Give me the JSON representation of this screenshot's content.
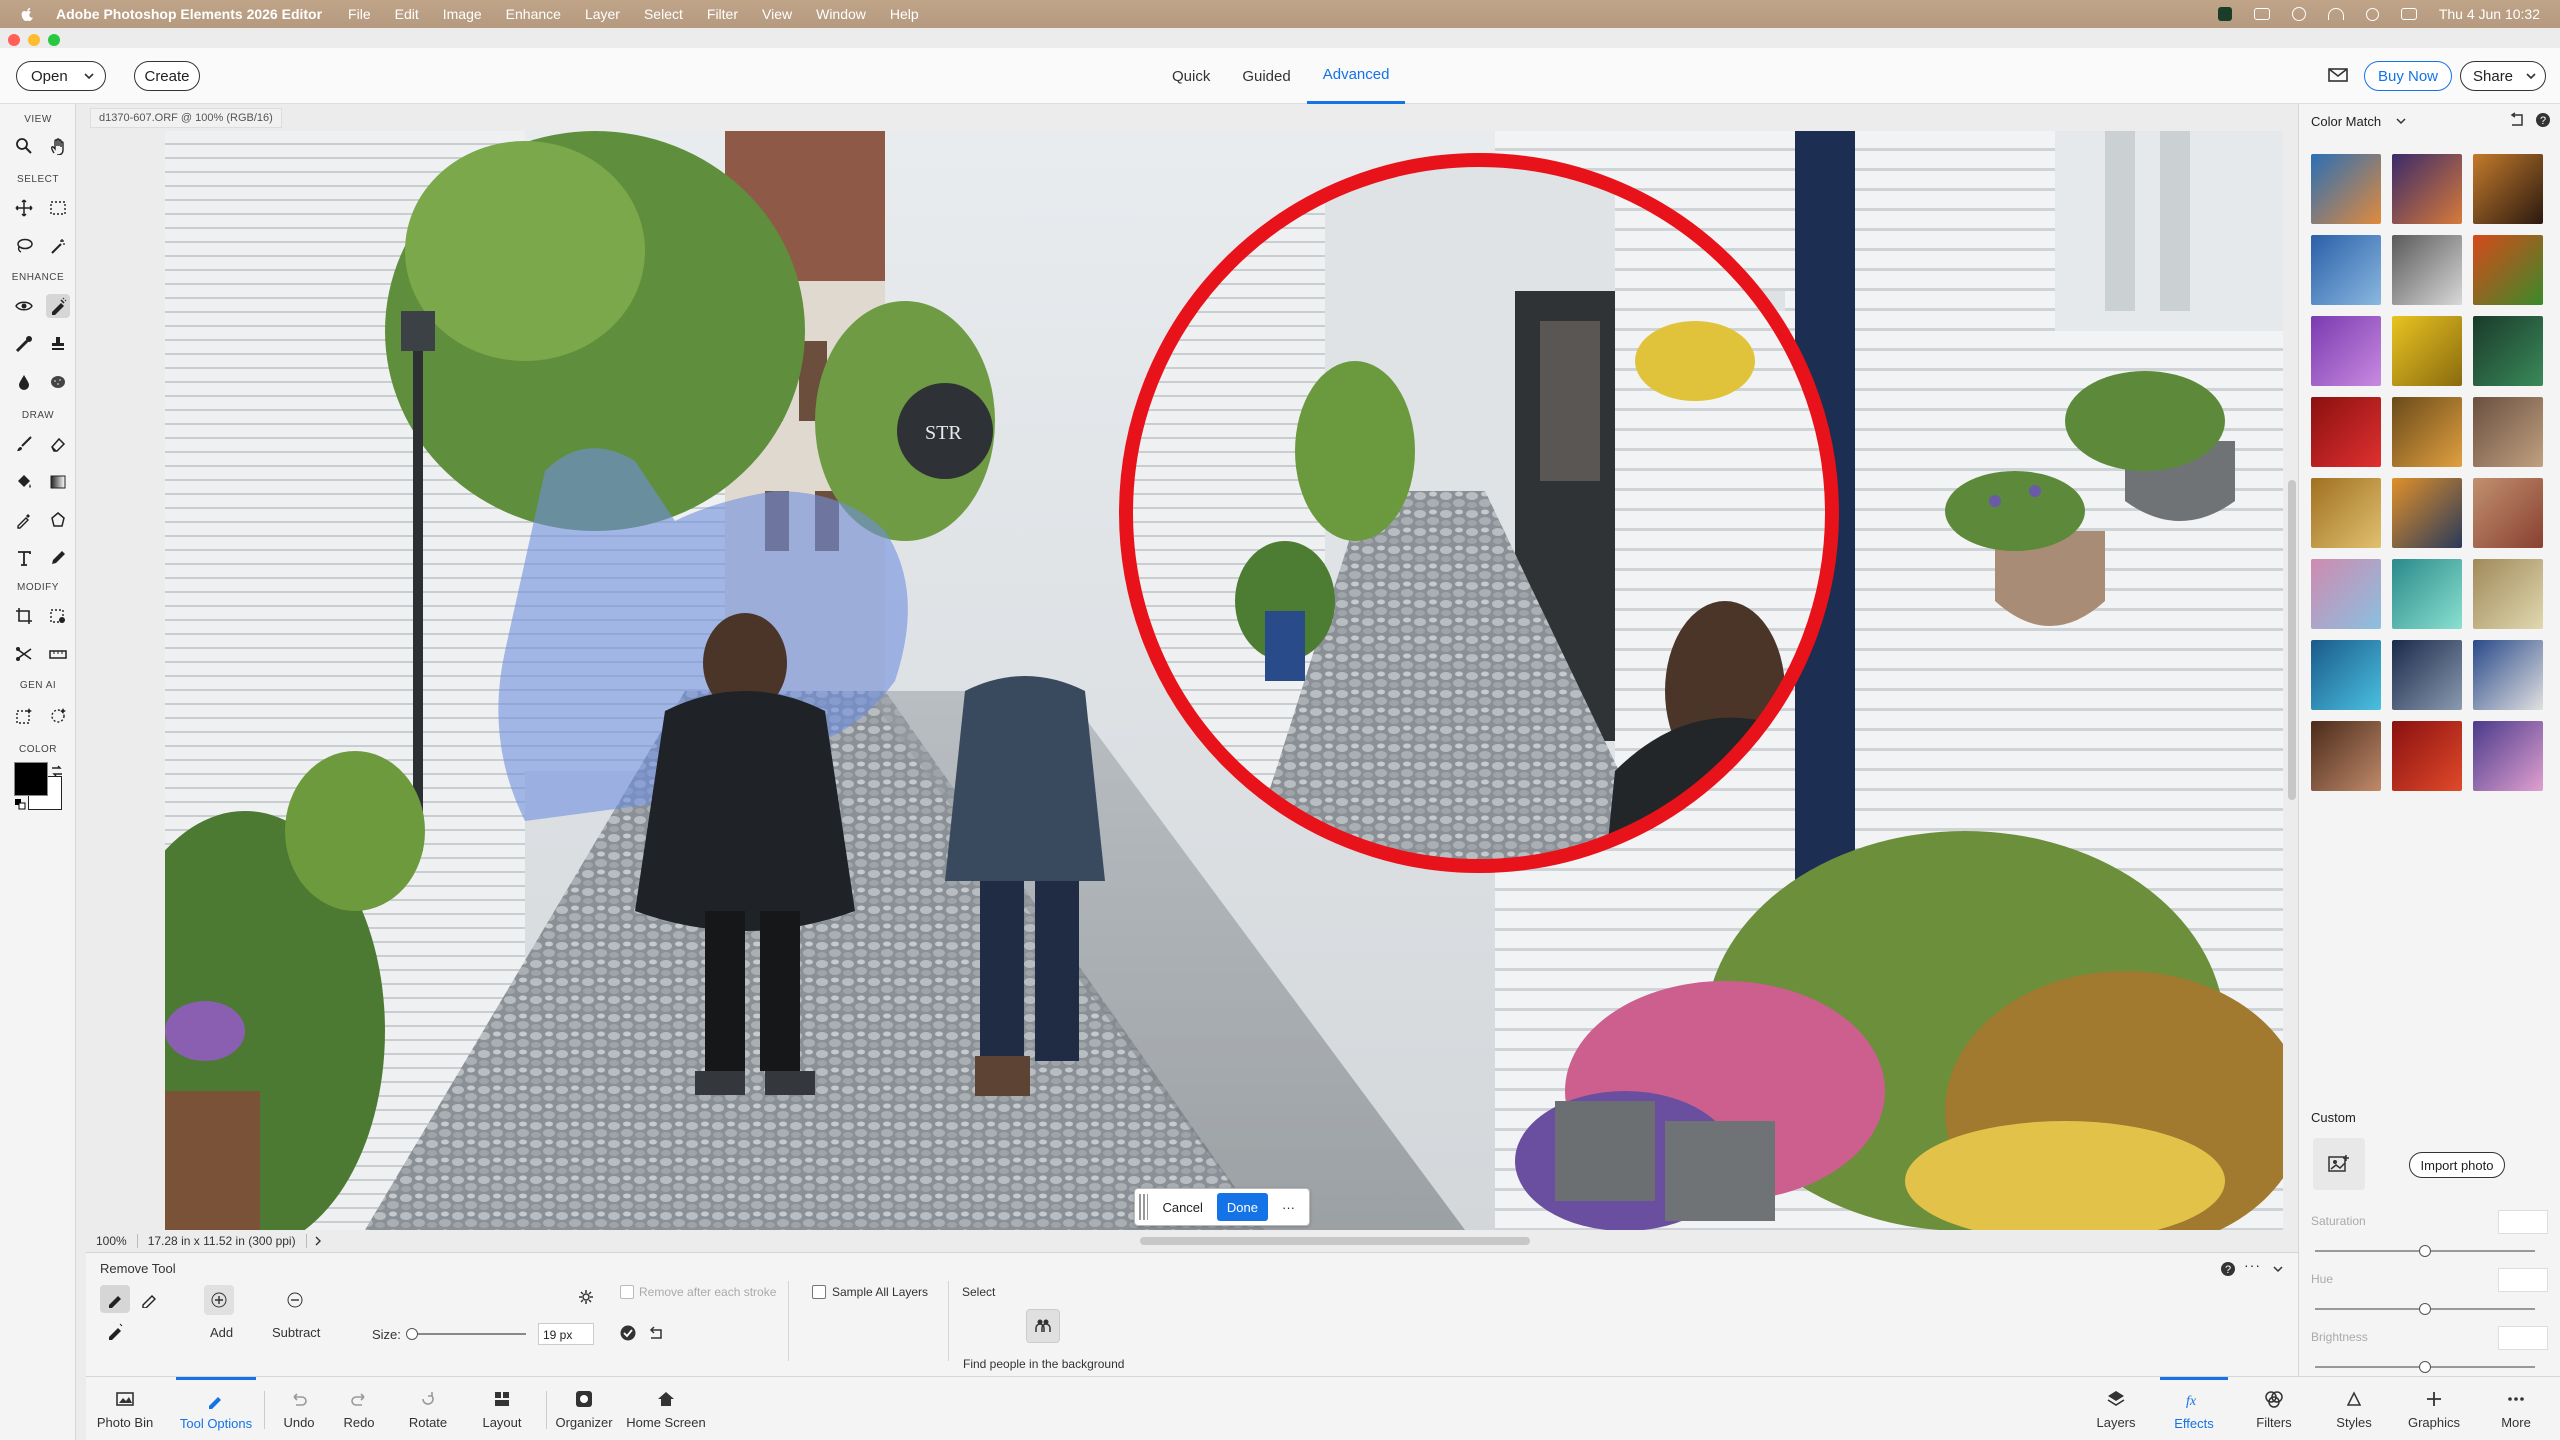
{
  "menubar": {
    "app_name": "Adobe Photoshop Elements 2026 Editor",
    "menus": [
      "File",
      "Edit",
      "Image",
      "Enhance",
      "Layer",
      "Select",
      "Filter",
      "View",
      "Window",
      "Help"
    ],
    "clock": "Thu 4 Jun  10:32"
  },
  "header": {
    "open_label": "Open",
    "create_label": "Create",
    "modes": [
      "Quick",
      "Guided",
      "Advanced"
    ],
    "active_mode": "Advanced",
    "buy_now_label": "Buy Now",
    "share_label": "Share"
  },
  "toolbox": {
    "sections": [
      "VIEW",
      "SELECT",
      "ENHANCE",
      "DRAW",
      "MODIFY",
      "GEN AI",
      "COLOR"
    ],
    "foreground_color": "#000000",
    "background_color": "#ffffff"
  },
  "document": {
    "tab_title": "d1370-607.ORF @ 100% (RGB/16)",
    "zoom": "100%",
    "dimensions": "17.28 in x 11.52 in (300 ppi)"
  },
  "donebar": {
    "cancel_label": "Cancel",
    "done_label": "Done",
    "more_label": "···"
  },
  "right_panel": {
    "title": "Color Match",
    "custom_label": "Custom",
    "import_label": "Import photo",
    "sliders": [
      "Saturation",
      "Hue",
      "Brightness"
    ]
  },
  "tool_options": {
    "tool_name": "Remove Tool",
    "add_label": "Add",
    "subtract_label": "Subtract",
    "size_label": "Size:",
    "size_value": "19 px",
    "remove_after_stroke": "Remove after each stroke",
    "sample_all_layers": "Sample All Layers",
    "select_label": "Select",
    "find_people": "Find people in the background"
  },
  "bottom_bar": {
    "photo_bin": "Photo Bin",
    "tool_options": "Tool Options",
    "undo": "Undo",
    "redo": "Redo",
    "rotate": "Rotate",
    "layout": "Layout",
    "organizer": "Organizer",
    "home_screen": "Home Screen",
    "layers": "Layers",
    "effects": "Effects",
    "filters": "Filters",
    "styles": "Styles",
    "graphics": "Graphics",
    "more": "More"
  },
  "colors": {
    "accent": "#1473e6",
    "magnifier_ring": "#e8121a",
    "selection_mask": "#6f8fe0"
  }
}
